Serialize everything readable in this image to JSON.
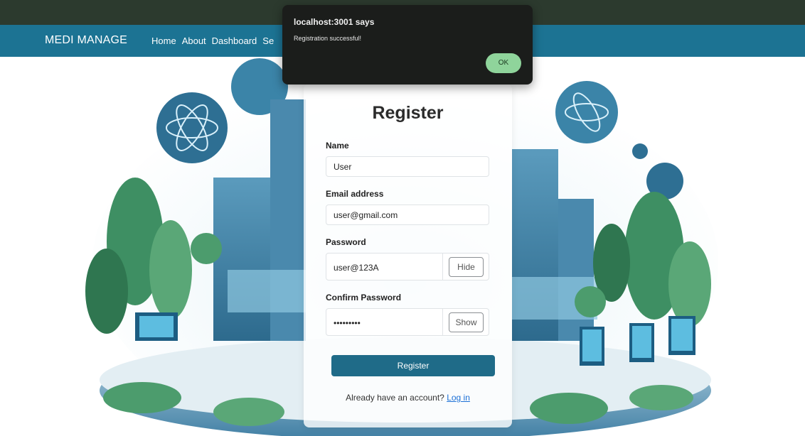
{
  "browser_dialog": {
    "title": "localhost:3001 says",
    "message": "Registration successful!",
    "ok_label": "OK"
  },
  "navbar": {
    "brand": "MEDI MANAGE",
    "links": [
      "Home",
      "About",
      "Dashboard",
      "Se"
    ]
  },
  "form": {
    "title": "Register",
    "name_label": "Name",
    "name_value": "User",
    "email_label": "Email address",
    "email_value": "user@gmail.com",
    "password_label": "Password",
    "password_value": "user@123A",
    "password_toggle": "Hide",
    "confirm_label": "Confirm Password",
    "confirm_value": "•••••••••",
    "confirm_toggle": "Show",
    "submit_label": "Register",
    "login_prompt": "Already have an account?",
    "login_link": "Log in"
  },
  "colors": {
    "navbar": "#1c7393",
    "topbar": "#2c3a2e",
    "primary_button": "#1f6b88",
    "dialog_bg": "#1b1d1b",
    "dialog_ok": "#8fd49b",
    "link": "#1a6fd6"
  }
}
